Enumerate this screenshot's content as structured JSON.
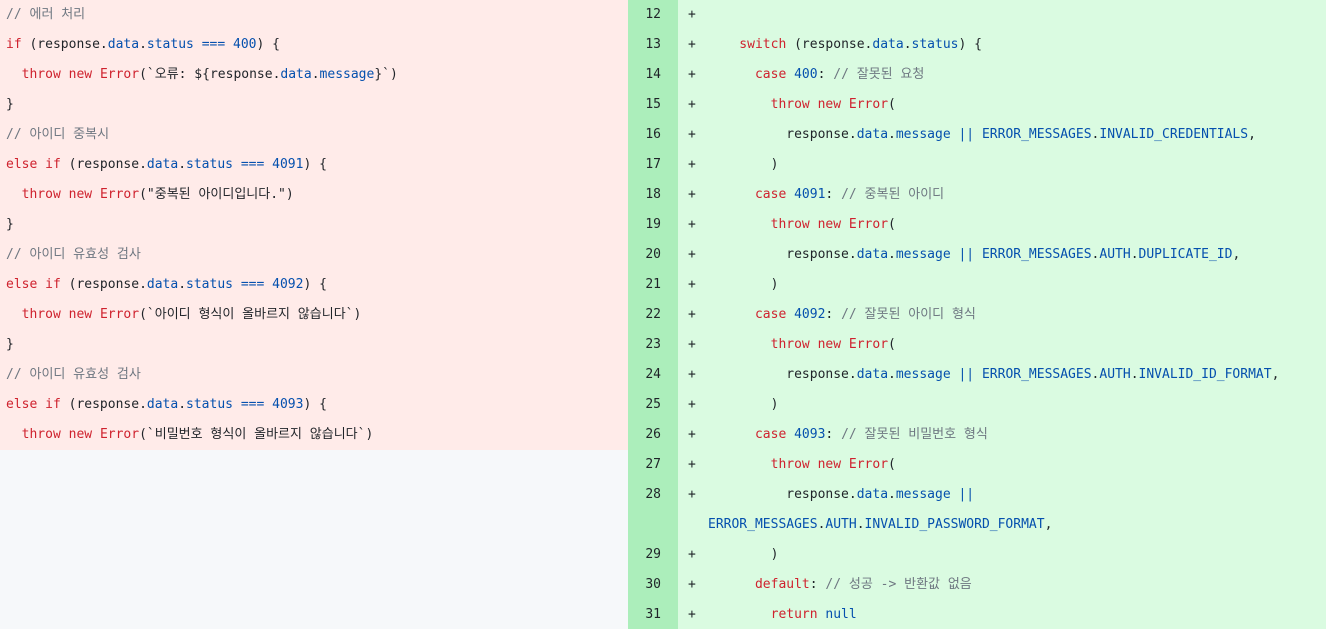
{
  "diff": {
    "left": {
      "lines": [
        [
          {
            "t": "// 에러 처리",
            "c": "cm"
          }
        ],
        [
          {
            "t": "if",
            "c": "kw"
          },
          {
            "t": " (response.",
            "c": "tx"
          },
          {
            "t": "data",
            "c": "blue"
          },
          {
            "t": ".",
            "c": "tx"
          },
          {
            "t": "status",
            "c": "blue"
          },
          {
            "t": " ",
            "c": "tx"
          },
          {
            "t": "===",
            "c": "blue"
          },
          {
            "t": " ",
            "c": "tx"
          },
          {
            "t": "400",
            "c": "blue"
          },
          {
            "t": ") {",
            "c": "tx"
          }
        ],
        [
          {
            "t": "  ",
            "c": "tx"
          },
          {
            "t": "throw",
            "c": "kw"
          },
          {
            "t": " ",
            "c": "tx"
          },
          {
            "t": "new",
            "c": "kw"
          },
          {
            "t": " ",
            "c": "tx"
          },
          {
            "t": "Error",
            "c": "kw"
          },
          {
            "t": "(`오류: ${response.",
            "c": "tx"
          },
          {
            "t": "data",
            "c": "blue"
          },
          {
            "t": ".",
            "c": "tx"
          },
          {
            "t": "message",
            "c": "blue"
          },
          {
            "t": "}`)",
            "c": "tx"
          }
        ],
        [
          {
            "t": "}",
            "c": "tx"
          }
        ],
        [
          {
            "t": "// 아이디 중복시",
            "c": "cm"
          }
        ],
        [
          {
            "t": "else",
            "c": "kw"
          },
          {
            "t": " ",
            "c": "tx"
          },
          {
            "t": "if",
            "c": "kw"
          },
          {
            "t": " (response.",
            "c": "tx"
          },
          {
            "t": "data",
            "c": "blue"
          },
          {
            "t": ".",
            "c": "tx"
          },
          {
            "t": "status",
            "c": "blue"
          },
          {
            "t": " ",
            "c": "tx"
          },
          {
            "t": "===",
            "c": "blue"
          },
          {
            "t": " ",
            "c": "tx"
          },
          {
            "t": "4091",
            "c": "blue"
          },
          {
            "t": ") {",
            "c": "tx"
          }
        ],
        [
          {
            "t": "  ",
            "c": "tx"
          },
          {
            "t": "throw",
            "c": "kw"
          },
          {
            "t": " ",
            "c": "tx"
          },
          {
            "t": "new",
            "c": "kw"
          },
          {
            "t": " ",
            "c": "tx"
          },
          {
            "t": "Error",
            "c": "kw"
          },
          {
            "t": "(\"중복된 아이디입니다.\")",
            "c": "tx"
          }
        ],
        [
          {
            "t": "}",
            "c": "tx"
          }
        ],
        [
          {
            "t": "// 아이디 유효성 검사",
            "c": "cm"
          }
        ],
        [
          {
            "t": "else",
            "c": "kw"
          },
          {
            "t": " ",
            "c": "tx"
          },
          {
            "t": "if",
            "c": "kw"
          },
          {
            "t": " (response.",
            "c": "tx"
          },
          {
            "t": "data",
            "c": "blue"
          },
          {
            "t": ".",
            "c": "tx"
          },
          {
            "t": "status",
            "c": "blue"
          },
          {
            "t": " ",
            "c": "tx"
          },
          {
            "t": "===",
            "c": "blue"
          },
          {
            "t": " ",
            "c": "tx"
          },
          {
            "t": "4092",
            "c": "blue"
          },
          {
            "t": ") {",
            "c": "tx"
          }
        ],
        [
          {
            "t": "  ",
            "c": "tx"
          },
          {
            "t": "throw",
            "c": "kw"
          },
          {
            "t": " ",
            "c": "tx"
          },
          {
            "t": "new",
            "c": "kw"
          },
          {
            "t": " ",
            "c": "tx"
          },
          {
            "t": "Error",
            "c": "kw"
          },
          {
            "t": "(`아이디 형식이 올바르지 않습니다`)",
            "c": "tx"
          }
        ],
        [
          {
            "t": "}",
            "c": "tx"
          }
        ],
        [
          {
            "t": "// 아이디 유효성 검사",
            "c": "cm"
          }
        ],
        [
          {
            "t": "else",
            "c": "kw"
          },
          {
            "t": " ",
            "c": "tx"
          },
          {
            "t": "if",
            "c": "kw"
          },
          {
            "t": " (response.",
            "c": "tx"
          },
          {
            "t": "data",
            "c": "blue"
          },
          {
            "t": ".",
            "c": "tx"
          },
          {
            "t": "status",
            "c": "blue"
          },
          {
            "t": " ",
            "c": "tx"
          },
          {
            "t": "===",
            "c": "blue"
          },
          {
            "t": " ",
            "c": "tx"
          },
          {
            "t": "4093",
            "c": "blue"
          },
          {
            "t": ") {",
            "c": "tx"
          }
        ],
        [
          {
            "t": "  ",
            "c": "tx"
          },
          {
            "t": "throw",
            "c": "kw"
          },
          {
            "t": " ",
            "c": "tx"
          },
          {
            "t": "new",
            "c": "kw"
          },
          {
            "t": " ",
            "c": "tx"
          },
          {
            "t": "Error",
            "c": "kw"
          },
          {
            "t": "(`비밀번호 형식이 올바르지 않습니다`)",
            "c": "tx"
          }
        ]
      ]
    },
    "right": {
      "sign": "+",
      "lines": [
        {
          "num": "12",
          "parts": []
        },
        {
          "num": "13",
          "parts": [
            {
              "t": "    switch",
              "c": "kw"
            },
            {
              "t": " (response.",
              "c": "tx"
            },
            {
              "t": "data",
              "c": "blue"
            },
            {
              "t": ".",
              "c": "tx"
            },
            {
              "t": "status",
              "c": "blue"
            },
            {
              "t": ") {",
              "c": "tx"
            }
          ]
        },
        {
          "num": "14",
          "parts": [
            {
              "t": "      case",
              "c": "kw"
            },
            {
              "t": " ",
              "c": "tx"
            },
            {
              "t": "400",
              "c": "blue"
            },
            {
              "t": ": ",
              "c": "tx"
            },
            {
              "t": "// 잘못된 요청",
              "c": "cm"
            }
          ]
        },
        {
          "num": "15",
          "parts": [
            {
              "t": "        throw",
              "c": "kw"
            },
            {
              "t": " ",
              "c": "tx"
            },
            {
              "t": "new",
              "c": "kw"
            },
            {
              "t": " ",
              "c": "tx"
            },
            {
              "t": "Error",
              "c": "kw"
            },
            {
              "t": "(",
              "c": "tx"
            }
          ]
        },
        {
          "num": "16",
          "parts": [
            {
              "t": "          response.",
              "c": "tx"
            },
            {
              "t": "data",
              "c": "blue"
            },
            {
              "t": ".",
              "c": "tx"
            },
            {
              "t": "message",
              "c": "blue"
            },
            {
              "t": " ",
              "c": "tx"
            },
            {
              "t": "||",
              "c": "blue"
            },
            {
              "t": " ",
              "c": "tx"
            },
            {
              "t": "ERROR_MESSAGES",
              "c": "blue"
            },
            {
              "t": ".",
              "c": "tx"
            },
            {
              "t": "INVALID_CREDENTIALS",
              "c": "blue"
            },
            {
              "t": ",",
              "c": "tx"
            }
          ]
        },
        {
          "num": "17",
          "parts": [
            {
              "t": "        )",
              "c": "tx"
            }
          ]
        },
        {
          "num": "18",
          "parts": [
            {
              "t": "      case",
              "c": "kw"
            },
            {
              "t": " ",
              "c": "tx"
            },
            {
              "t": "4091",
              "c": "blue"
            },
            {
              "t": ": ",
              "c": "tx"
            },
            {
              "t": "// 중복된 아이디",
              "c": "cm"
            }
          ]
        },
        {
          "num": "19",
          "parts": [
            {
              "t": "        throw",
              "c": "kw"
            },
            {
              "t": " ",
              "c": "tx"
            },
            {
              "t": "new",
              "c": "kw"
            },
            {
              "t": " ",
              "c": "tx"
            },
            {
              "t": "Error",
              "c": "kw"
            },
            {
              "t": "(",
              "c": "tx"
            }
          ]
        },
        {
          "num": "20",
          "parts": [
            {
              "t": "          response.",
              "c": "tx"
            },
            {
              "t": "data",
              "c": "blue"
            },
            {
              "t": ".",
              "c": "tx"
            },
            {
              "t": "message",
              "c": "blue"
            },
            {
              "t": " ",
              "c": "tx"
            },
            {
              "t": "||",
              "c": "blue"
            },
            {
              "t": " ",
              "c": "tx"
            },
            {
              "t": "ERROR_MESSAGES",
              "c": "blue"
            },
            {
              "t": ".",
              "c": "tx"
            },
            {
              "t": "AUTH",
              "c": "blue"
            },
            {
              "t": ".",
              "c": "tx"
            },
            {
              "t": "DUPLICATE_ID",
              "c": "blue"
            },
            {
              "t": ",",
              "c": "tx"
            }
          ]
        },
        {
          "num": "21",
          "parts": [
            {
              "t": "        )",
              "c": "tx"
            }
          ]
        },
        {
          "num": "22",
          "parts": [
            {
              "t": "      case",
              "c": "kw"
            },
            {
              "t": " ",
              "c": "tx"
            },
            {
              "t": "4092",
              "c": "blue"
            },
            {
              "t": ": ",
              "c": "tx"
            },
            {
              "t": "// 잘못된 아이디 형식",
              "c": "cm"
            }
          ]
        },
        {
          "num": "23",
          "parts": [
            {
              "t": "        throw",
              "c": "kw"
            },
            {
              "t": " ",
              "c": "tx"
            },
            {
              "t": "new",
              "c": "kw"
            },
            {
              "t": " ",
              "c": "tx"
            },
            {
              "t": "Error",
              "c": "kw"
            },
            {
              "t": "(",
              "c": "tx"
            }
          ]
        },
        {
          "num": "24",
          "parts": [
            {
              "t": "          response.",
              "c": "tx"
            },
            {
              "t": "data",
              "c": "blue"
            },
            {
              "t": ".",
              "c": "tx"
            },
            {
              "t": "message",
              "c": "blue"
            },
            {
              "t": " ",
              "c": "tx"
            },
            {
              "t": "||",
              "c": "blue"
            },
            {
              "t": " ",
              "c": "tx"
            },
            {
              "t": "ERROR_MESSAGES",
              "c": "blue"
            },
            {
              "t": ".",
              "c": "tx"
            },
            {
              "t": "AUTH",
              "c": "blue"
            },
            {
              "t": ".",
              "c": "tx"
            },
            {
              "t": "INVALID_ID_FORMAT",
              "c": "blue"
            },
            {
              "t": ",",
              "c": "tx"
            }
          ]
        },
        {
          "num": "25",
          "parts": [
            {
              "t": "        )",
              "c": "tx"
            }
          ]
        },
        {
          "num": "26",
          "parts": [
            {
              "t": "      case",
              "c": "kw"
            },
            {
              "t": " ",
              "c": "tx"
            },
            {
              "t": "4093",
              "c": "blue"
            },
            {
              "t": ": ",
              "c": "tx"
            },
            {
              "t": "// 잘못된 비밀번호 형식",
              "c": "cm"
            }
          ]
        },
        {
          "num": "27",
          "parts": [
            {
              "t": "        throw",
              "c": "kw"
            },
            {
              "t": " ",
              "c": "tx"
            },
            {
              "t": "new",
              "c": "kw"
            },
            {
              "t": " ",
              "c": "tx"
            },
            {
              "t": "Error",
              "c": "kw"
            },
            {
              "t": "(",
              "c": "tx"
            }
          ]
        },
        {
          "num": "28",
          "parts": [
            {
              "t": "          response.",
              "c": "tx"
            },
            {
              "t": "data",
              "c": "blue"
            },
            {
              "t": ".",
              "c": "tx"
            },
            {
              "t": "message",
              "c": "blue"
            },
            {
              "t": " ",
              "c": "tx"
            },
            {
              "t": "||",
              "c": "blue"
            }
          ],
          "wrap": [
            {
              "t": "ERROR_MESSAGES",
              "c": "blue"
            },
            {
              "t": ".",
              "c": "tx"
            },
            {
              "t": "AUTH",
              "c": "blue"
            },
            {
              "t": ".",
              "c": "tx"
            },
            {
              "t": "INVALID_PASSWORD_FORMAT",
              "c": "blue"
            },
            {
              "t": ",",
              "c": "tx"
            }
          ]
        },
        {
          "num": "29",
          "parts": [
            {
              "t": "        )",
              "c": "tx"
            }
          ]
        },
        {
          "num": "30",
          "parts": [
            {
              "t": "      default",
              "c": "kw"
            },
            {
              "t": ": ",
              "c": "tx"
            },
            {
              "t": "// 성공 -> 반환값 없음",
              "c": "cm"
            }
          ]
        },
        {
          "num": "31",
          "parts": [
            {
              "t": "        return",
              "c": "kw"
            },
            {
              "t": " ",
              "c": "tx"
            },
            {
              "t": "null",
              "c": "blue"
            }
          ]
        }
      ]
    }
  }
}
